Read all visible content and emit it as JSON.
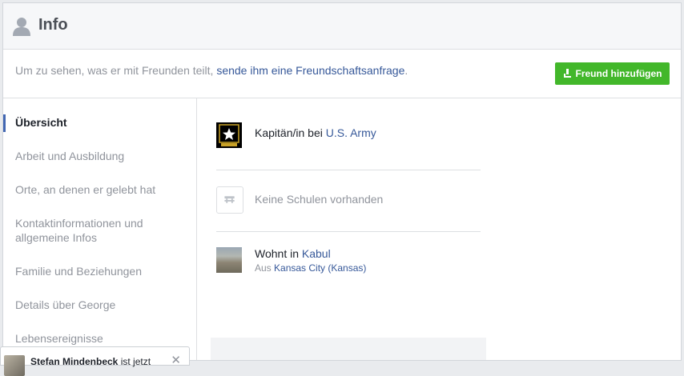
{
  "header": {
    "title": "Info",
    "icon": "person-icon"
  },
  "notice": {
    "text": "Um zu sehen, was er mit Freunden teilt, ",
    "link": "sende ihm eine Freundschaftsanfrage",
    "end": "."
  },
  "add_button": {
    "label": "Freund hinzufügen",
    "color": "#42b72a"
  },
  "sidebar": {
    "accent": "#4267b2",
    "items": [
      {
        "label": "Übersicht",
        "active": true
      },
      {
        "label": "Arbeit und Ausbildung"
      },
      {
        "label": "Orte, an denen er gelebt hat"
      },
      {
        "label": "Kontaktinformationen und allgemeine Infos"
      },
      {
        "label": "Familie und Beziehungen"
      },
      {
        "label": "Details über George"
      },
      {
        "label": "Lebensereignisse"
      }
    ]
  },
  "overview": {
    "work": {
      "prefix": "Kapitän/in bei ",
      "link": "U.S. Army",
      "logo_text": "U.S.ARMY"
    },
    "school": {
      "text": "Keine Schulen vorhanden"
    },
    "lives": {
      "prefix": "Wohnt in ",
      "city": "Kabul",
      "from_prefix": "Aus ",
      "from": "Kansas City (Kansas)"
    }
  },
  "chat": {
    "name": "Stefan Mindenbeck",
    "suffix": " ist jetzt"
  },
  "colors": {
    "link": "#365899",
    "muted": "#90949c",
    "text": "#1d2129"
  }
}
